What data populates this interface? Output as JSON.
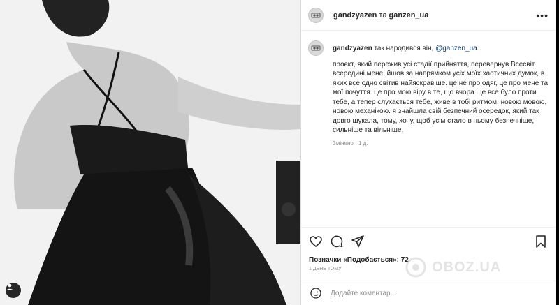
{
  "post": {
    "author": "gandzyazen",
    "connector": "та",
    "collaborator": "ganzen_ua"
  },
  "caption": {
    "author": "gandzyazen",
    "first_line": "так народився він,",
    "mention": "@ganzen_ua",
    "mention_suffix": ".",
    "body": "проєкт, який пережив усі стадії прийняття, перевернув Всесвіт всередині мене, йшов за напрямком усіх моїх хаотичних думок, в яких все одно світив найяскравіше. це не про одяг, це про мене та мої почуття. це про мою віру в те, що вчора ще все було проти тебе, а тепер слухається тебе, живе в тобі ритмом, новою мовою, новою механікою. я знайшла свій безпечний осередок, який так довго шукала, тому, хочу, щоб усім стало в ньому безпечніше, сильніше та вільніше.",
    "meta": "Змінено · 1 д."
  },
  "likes": "Позначки «Подобається»: 72",
  "time_ago": "1 день тому",
  "comment": {
    "placeholder": "Додайте коментар..."
  },
  "watermark": "OBOZ.UA",
  "icons": {
    "more": "more-options-icon",
    "like": "heart-icon",
    "comment": "comment-icon",
    "share": "share-icon",
    "save": "bookmark-icon",
    "emoji": "emoji-icon",
    "user": "user-tag-icon"
  }
}
